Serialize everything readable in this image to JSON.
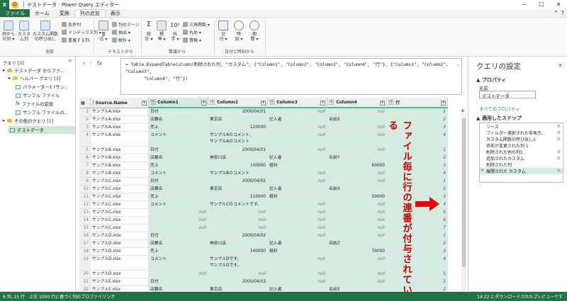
{
  "app": {
    "icon": "X",
    "title": "テストデータ - Power Query エディター"
  },
  "tabs": [
    "ファイル",
    "ホーム",
    "変換",
    "列の追加",
    "表示"
  ],
  "ribbon": {
    "buttons": [
      {
        "label": "例から\nの列 ▾"
      },
      {
        "label": "カスタ\nム列"
      },
      {
        "label": "カスタム関数\nの呼び出し"
      },
      {
        "label": "書\n式 ▾"
      },
      {
        "label": "標\n準 ▾"
      },
      {
        "label": "科\n学 ▾"
      },
      {
        "label": "日\n付 ▾"
      },
      {
        "label": "時\n刻 ▾"
      },
      {
        "label": "期\n間 ▾"
      },
      {
        "label": "統\n計 ▾"
      }
    ],
    "small": [
      "条件列",
      "インデックス列 ▾",
      "重複する列",
      "列のマージ",
      "抽出 ▾",
      "解析 ▾",
      "三角関数 ▾",
      "丸め ▾",
      "情報 ▾"
    ],
    "groups": [
      "全般",
      "テキストから",
      "数値から",
      "日付と時刻から"
    ]
  },
  "queries": {
    "header": "クエリ [5]",
    "items": [
      "テストデータ からファ...",
      "ヘルパー クエリ [3]",
      "パラメーター1 (サン...",
      "サンプル ファイル",
      "ファイルの変換",
      "サンプル ファイルの...",
      "その他のクエリ [1]",
      "テストデータ"
    ]
  },
  "formula": {
    "line1": "= Table.ExpandTableColumn(削除された列, \"カスタム\", {\"Column1\", \"Column2\", \"Column3\", \"Column4\", \"行\"}, {\"Column1\", \"Column2\", \"Column3\",",
    "line2": "\"Column4\", \"行\"})"
  },
  "grid": {
    "headers": [
      "Source.Name",
      "Column1",
      "Column2",
      "Column3",
      "Column4",
      "行"
    ],
    "rows": [
      [
        "1",
        "サンプルA.xlsx",
        "日付",
        "2000/04/01",
        "null",
        "null",
        "1"
      ],
      [
        "2",
        "サンプルA.xlsx",
        "店舗名",
        "東京店",
        "記入者",
        "名前X",
        "2"
      ],
      [
        "3",
        "サンプルA.xlsx",
        "売上",
        "120000",
        "null",
        "null",
        "3"
      ],
      [
        "4",
        "サンプルA.xlsx",
        "コメント",
        "サンプルAのコメント、\nサンプルAのコメント",
        "null",
        "null",
        "4"
      ],
      [
        "5",
        "サンプルB.xlsx",
        "日付",
        "2000/04/01",
        "null",
        "null",
        "1"
      ],
      [
        "6",
        "サンプルB.xlsx",
        "店舗名",
        "神奈川店",
        "記入者",
        "名前Y",
        "2"
      ],
      [
        "7",
        "サンプルB.xlsx",
        "売上",
        "100000",
        "粗利",
        "60000",
        "3"
      ],
      [
        "8",
        "サンプルB.xlsx",
        "コメント",
        "サンプルBのコメント",
        "null",
        "null",
        "4"
      ],
      [
        "9",
        "サンプルC.xlsx",
        "日付",
        "2000/04/02",
        "null",
        "null",
        "1"
      ],
      [
        "10",
        "サンプルC.xlsx",
        "店舗名",
        "東京店",
        "記入者",
        "名前X",
        "2"
      ],
      [
        "11",
        "サンプルC.xlsx",
        "売上",
        "110000",
        "粗利",
        "50000",
        "3"
      ],
      [
        "12",
        "サンプルC.xlsx",
        "コメント",
        "サンプルCのコメントです。",
        "null",
        "null",
        "4"
      ],
      [
        "13",
        "サンプルC.xlsx",
        "null",
        "null",
        "null",
        "null",
        "5"
      ],
      [
        "14",
        "サンプルC.xlsx",
        "null",
        "null",
        "null",
        "null",
        "6"
      ],
      [
        "15",
        "サンプルC.xlsx",
        "null",
        "null",
        "null",
        "null",
        "7"
      ],
      [
        "16",
        "サンプルD.xlsx",
        "日付",
        "2000/04/02",
        "null",
        "null",
        "1"
      ],
      [
        "17",
        "サンプルD.xlsx",
        "店舗名",
        "神奈川店",
        "記入者",
        "名前Z",
        "2"
      ],
      [
        "18",
        "サンプルD.xlsx",
        "売上",
        "140000",
        "粗利",
        "70000",
        "3"
      ],
      [
        "19",
        "サンプルD.xlsx",
        "コメント",
        "サンプルDです。\nサンプルDです。",
        "null",
        "null",
        "4"
      ],
      [
        "20",
        "サンプルD.xlsx",
        "null",
        "null",
        "null",
        "null",
        "5"
      ],
      [
        "21",
        "サンプルE.xlsx",
        "日付",
        "2000/04/03",
        "null",
        "null",
        "1"
      ],
      [
        "22",
        "サンプルE.xlsx",
        "店舗名",
        "東京店",
        "記入者",
        "名前X",
        "2"
      ],
      [
        "23",
        "サンプルE.xlsx",
        "売上",
        "150000",
        "粗利",
        "",
        "3"
      ]
    ]
  },
  "annotation": "ファイル毎に行の連番が付与されている",
  "settings": {
    "title": "クエリの設定",
    "properties_header": "▲ プロパティ",
    "name_label": "名前",
    "name_value": "テストデータ",
    "all_props": "すべてのプロパティ",
    "steps_header": "▲ 適用したステップ",
    "steps": [
      "ソース",
      "フィルター選択された非表示...",
      "カスタム関数の呼び出し1",
      "名前が変更された列 1",
      "削除された他の列1",
      "追加されたカスタム",
      "削除された列",
      "展開された カスタム"
    ]
  },
  "status": {
    "left": "6 列, 25 行　上位 1000 行に基づく列のプロファイリング",
    "right": "14:22 にダウンロードされたプレビューです"
  }
}
